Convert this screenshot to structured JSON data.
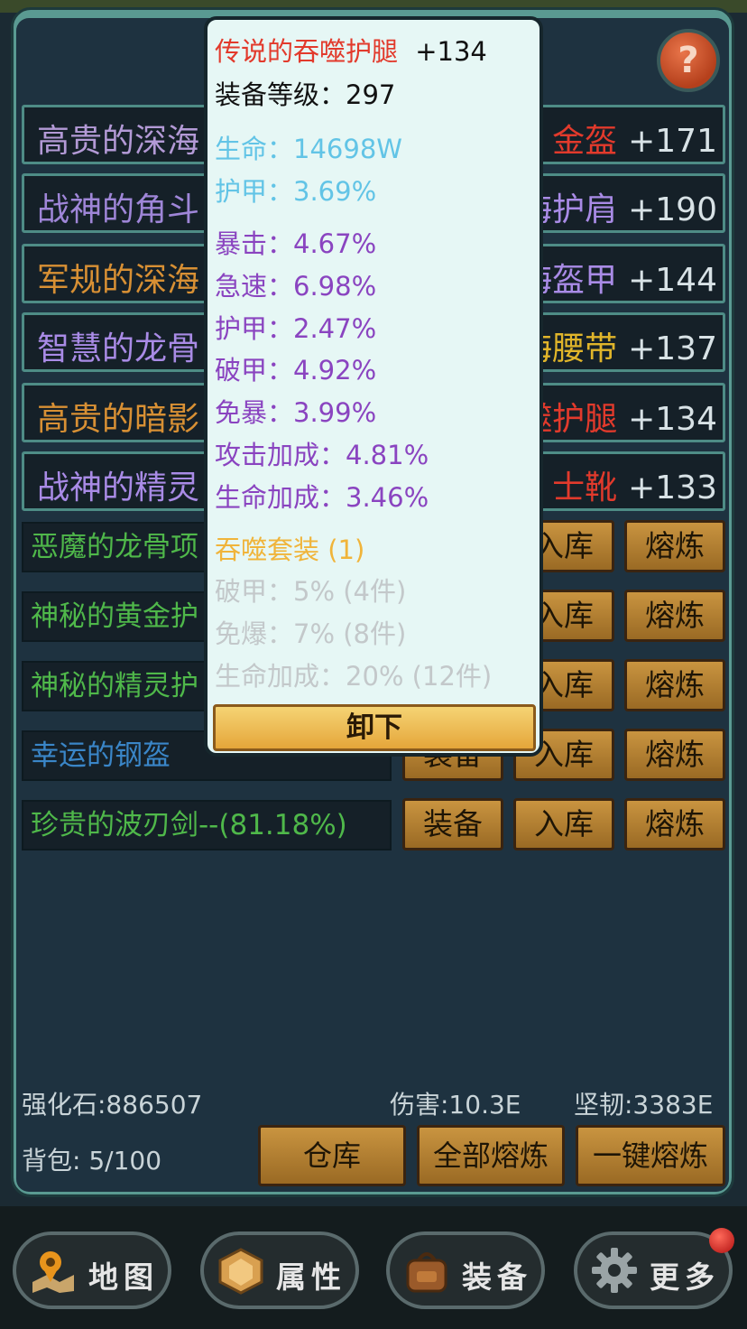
{
  "help_label": "?",
  "equipped": [
    {
      "left": "高贵的深海",
      "right": "金盔",
      "plus": "+171",
      "lc": "#b39ad6",
      "rc": "#e23a2c"
    },
    {
      "left": "战神的角斗",
      "right": "海护肩",
      "plus": "+190",
      "lc": "#9f86d8",
      "rc": "#a98be6"
    },
    {
      "left": "军规的深海",
      "right": "海盔甲",
      "plus": "+144",
      "lc": "#d89034",
      "rc": "#a98be6"
    },
    {
      "left": "智慧的龙骨",
      "right": "海腰带",
      "plus": "+137",
      "lc": "#a98be6",
      "rc": "#e0b52a"
    },
    {
      "left": "高贵的暗影",
      "right": "噬护腿",
      "plus": "+134",
      "lc": "#d89034",
      "rc": "#e23a2c"
    },
    {
      "left": "战神的精灵",
      "right": "士靴",
      "plus": "+133",
      "lc": "#a98be6",
      "rc": "#e23a2c"
    }
  ],
  "bag": [
    {
      "name": "恶魔的龙骨项",
      "color": "#4fb84a",
      "buttons": [
        "入库",
        "熔炼"
      ]
    },
    {
      "name": "神秘的黄金护",
      "color": "#4fb84a",
      "buttons": [
        "入库",
        "熔炼"
      ]
    },
    {
      "name": "神秘的精灵护",
      "color": "#4fb84a",
      "buttons": [
        "入库",
        "熔炼"
      ]
    },
    {
      "name": "幸运的钢盔",
      "color": "#3a86c8",
      "buttons": [
        "装备",
        "入库",
        "熔炼"
      ]
    },
    {
      "name": "珍贵的波刃剑--(81.18%)",
      "color": "#4fb84a",
      "buttons": [
        "装备",
        "入库",
        "熔炼"
      ]
    }
  ],
  "footer": {
    "stone": "强化石:886507",
    "damage": "伤害:10.3E",
    "tough": "坚韧:3383E",
    "bag": "背包: 5/100",
    "btn_warehouse": "仓库",
    "btn_smelt_all": "全部熔炼",
    "btn_one_key": "一键熔炼"
  },
  "nav": [
    {
      "label": "地图",
      "icon": "map-icon"
    },
    {
      "label": "属性",
      "icon": "attribute-icon"
    },
    {
      "label": "装备",
      "icon": "backpack-icon"
    },
    {
      "label": "更多",
      "icon": "gear-icon"
    }
  ],
  "tooltip": {
    "name": "传说的吞噬护腿",
    "plus": "+134",
    "level": "装备等级：297",
    "base": [
      {
        "label": "生命：",
        "value": "14698W"
      },
      {
        "label": "护甲：",
        "value": "3.69%"
      }
    ],
    "extra": [
      {
        "label": "暴击：",
        "value": "4.67%"
      },
      {
        "label": "急速：",
        "value": "6.98%"
      },
      {
        "label": "护甲：",
        "value": "2.47%"
      },
      {
        "label": "破甲：",
        "value": "4.92%"
      },
      {
        "label": "免暴：",
        "value": "3.99%"
      },
      {
        "label": "攻击加成：",
        "value": "4.81%"
      },
      {
        "label": "生命加成：",
        "value": "3.46%"
      }
    ],
    "set_title": "吞噬套装 (1)",
    "set_bonus": [
      "破甲：5% (4件)",
      "免爆：7% (8件)",
      "生命加成：20% (12件)"
    ],
    "unequip": "卸下"
  },
  "colors": {
    "tooltip_red": "#e23a2c",
    "base_blue": "#62c4e6",
    "extra_purple": "#8a44c0",
    "set_gold": "#f0b43a",
    "set_grey": "#c3c8ca"
  }
}
